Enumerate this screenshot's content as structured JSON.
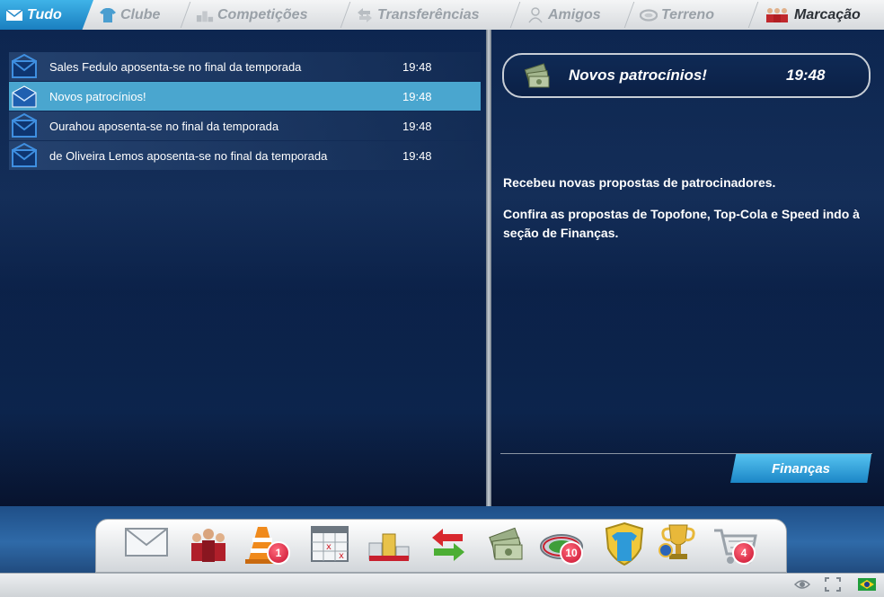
{
  "tabs": [
    {
      "label": "Tudo",
      "icon": "envelope-icon",
      "active": true
    },
    {
      "label": "Clube",
      "icon": "shirt-icon",
      "active": false
    },
    {
      "label": "Competições",
      "icon": "podium-icon",
      "active": false
    },
    {
      "label": "Transferências",
      "icon": "transfer-arrows-icon",
      "active": false
    },
    {
      "label": "Amigos",
      "icon": "person-icon",
      "active": false
    },
    {
      "label": "Terreno",
      "icon": "stadium-icon",
      "active": false
    },
    {
      "label": "Marcação",
      "icon": "players-icon",
      "active": false
    }
  ],
  "messages": [
    {
      "subject": "Sales Fedulo aposenta-se no final da temporada",
      "time": "19:48",
      "icon": "envelope-icon"
    },
    {
      "subject": "Novos patrocínios!",
      "time": "19:48",
      "icon": "envelope-open-icon",
      "selected": true
    },
    {
      "subject": "Ourahou aposenta-se no final da temporada",
      "time": "19:48",
      "icon": "envelope-icon"
    },
    {
      "subject": "de Oliveira Lemos aposenta-se no final da temporada",
      "time": "19:48",
      "icon": "envelope-icon"
    }
  ],
  "detail": {
    "title": "Novos patrocínios!",
    "time": "19:48",
    "icon": "money-icon",
    "paragraph1": "Recebeu novas propostas de patrocinadores.",
    "paragraph2": "Confira as propostas de Topofone, Top-Cola e Speed indo à seção de Finanças.",
    "button": "Finanças"
  },
  "dock": [
    {
      "icon": "mail-icon"
    },
    {
      "icon": "team-players-icon"
    },
    {
      "icon": "training-cone-icon",
      "badge": "1"
    },
    {
      "icon": "calendar-icon"
    },
    {
      "icon": "podium-icon"
    },
    {
      "icon": "transfer-arrows-icon"
    },
    {
      "icon": "money-icon"
    },
    {
      "icon": "stadium-icon",
      "badge": "10"
    },
    {
      "icon": "shirt-shield-icon"
    },
    {
      "icon": "trophy-icon"
    },
    {
      "icon": "shop-cart-icon",
      "badge": "4"
    }
  ],
  "status_icons": [
    "eye-icon",
    "fullscreen-icon",
    "brazil-flag-icon"
  ],
  "colors": {
    "accent": "#2a9ad6",
    "selected_row": "#4aa6cf",
    "badge": "#c8102e",
    "panel": "#0b2148"
  }
}
